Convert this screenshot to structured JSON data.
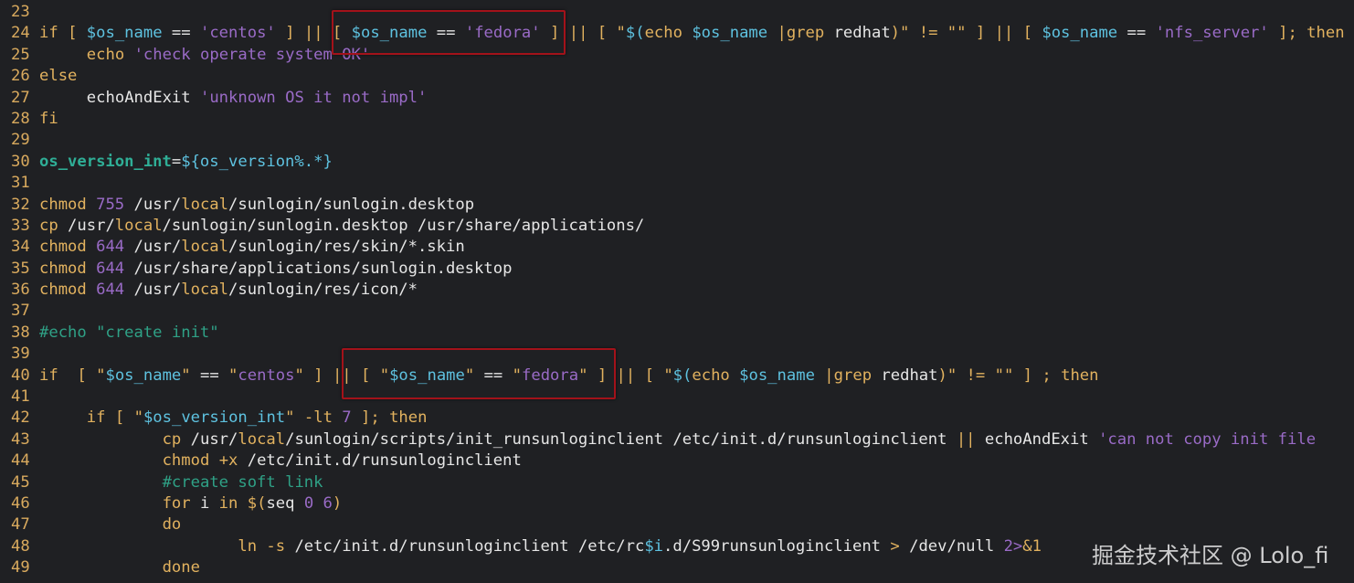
{
  "colors": {
    "background": "#1f2023",
    "keyword": "#e2b25f",
    "string": "#9a6bc7",
    "variable": "#5ec2e0",
    "comment": "#2fa186",
    "highlight_box": "#a3121a"
  },
  "watermark": "掘金技术社区 @ Lolo_fi",
  "lines": [
    {
      "n": "23",
      "tokens": []
    },
    {
      "n": "24",
      "tokens": [
        [
          "k",
          "if"
        ],
        [
          "t",
          " "
        ],
        [
          "k",
          "["
        ],
        [
          "t",
          " "
        ],
        [
          "v",
          "$os_name"
        ],
        [
          "t",
          " == "
        ],
        [
          "s",
          "'centos'"
        ],
        [
          "t",
          " "
        ],
        [
          "k",
          "]"
        ],
        [
          "t",
          " "
        ],
        [
          "k",
          "||"
        ],
        [
          "t",
          " "
        ],
        [
          "k",
          "["
        ],
        [
          "t",
          " "
        ],
        [
          "v",
          "$os_name"
        ],
        [
          "t",
          " == "
        ],
        [
          "s",
          "'fedora'"
        ],
        [
          "t",
          " "
        ],
        [
          "k",
          "]"
        ],
        [
          "t",
          " "
        ],
        [
          "k",
          "||"
        ],
        [
          "t",
          " "
        ],
        [
          "k",
          "["
        ],
        [
          "t",
          " "
        ],
        [
          "k",
          "\""
        ],
        [
          "v",
          "$("
        ],
        [
          "k",
          "echo"
        ],
        [
          "t",
          " "
        ],
        [
          "v",
          "$os_name"
        ],
        [
          "t",
          " "
        ],
        [
          "k",
          "|grep"
        ],
        [
          "t",
          " redhat"
        ],
        [
          "k",
          ")\""
        ],
        [
          "t",
          " "
        ],
        [
          "k",
          "!="
        ],
        [
          "t",
          " "
        ],
        [
          "k",
          "\"\""
        ],
        [
          "t",
          " "
        ],
        [
          "k",
          "]"
        ],
        [
          "t",
          " "
        ],
        [
          "k",
          "||"
        ],
        [
          "t",
          " "
        ],
        [
          "k",
          "["
        ],
        [
          "t",
          " "
        ],
        [
          "v",
          "$os_name"
        ],
        [
          "t",
          " == "
        ],
        [
          "s",
          "'nfs_server'"
        ],
        [
          "t",
          " "
        ],
        [
          "k",
          "];"
        ],
        [
          "t",
          " "
        ],
        [
          "k",
          "then"
        ]
      ]
    },
    {
      "n": "25",
      "tokens": [
        [
          "t",
          "\t"
        ],
        [
          "k",
          "echo"
        ],
        [
          "t",
          " "
        ],
        [
          "s",
          "'check operate system OK'"
        ]
      ]
    },
    {
      "n": "26",
      "tokens": [
        [
          "k",
          "else"
        ]
      ]
    },
    {
      "n": "27",
      "tokens": [
        [
          "t",
          "\techoAndExit "
        ],
        [
          "s",
          "'unknown OS it not impl'"
        ]
      ]
    },
    {
      "n": "28",
      "tokens": [
        [
          "k",
          "fi"
        ]
      ]
    },
    {
      "n": "29",
      "tokens": []
    },
    {
      "n": "30",
      "tokens": [
        [
          "g",
          "os_version_int"
        ],
        [
          "t",
          "="
        ],
        [
          "v",
          "${os_version%.*}"
        ]
      ]
    },
    {
      "n": "31",
      "tokens": []
    },
    {
      "n": "32",
      "tokens": [
        [
          "k",
          "chmod"
        ],
        [
          "t",
          " "
        ],
        [
          "n",
          "755"
        ],
        [
          "t",
          " /usr/"
        ],
        [
          "k",
          "local"
        ],
        [
          "t",
          "/sunlogin/sunlogin.desktop"
        ]
      ]
    },
    {
      "n": "33",
      "tokens": [
        [
          "k",
          "cp"
        ],
        [
          "t",
          " /usr/"
        ],
        [
          "k",
          "local"
        ],
        [
          "t",
          "/sunlogin/sunlogin.desktop /usr/share/applications/"
        ]
      ]
    },
    {
      "n": "34",
      "tokens": [
        [
          "k",
          "chmod"
        ],
        [
          "t",
          " "
        ],
        [
          "n",
          "644"
        ],
        [
          "t",
          " /usr/"
        ],
        [
          "k",
          "local"
        ],
        [
          "t",
          "/sunlogin/res/skin/*.skin"
        ]
      ]
    },
    {
      "n": "35",
      "tokens": [
        [
          "k",
          "chmod"
        ],
        [
          "t",
          " "
        ],
        [
          "n",
          "644"
        ],
        [
          "t",
          " /usr/share/applications/sunlogin.desktop"
        ]
      ]
    },
    {
      "n": "36",
      "tokens": [
        [
          "k",
          "chmod"
        ],
        [
          "t",
          " "
        ],
        [
          "n",
          "644"
        ],
        [
          "t",
          " /usr/"
        ],
        [
          "k",
          "local"
        ],
        [
          "t",
          "/sunlogin/res/icon/*"
        ]
      ]
    },
    {
      "n": "37",
      "tokens": []
    },
    {
      "n": "38",
      "tokens": [
        [
          "c",
          "#echo \"create init\""
        ]
      ]
    },
    {
      "n": "39",
      "tokens": []
    },
    {
      "n": "40",
      "tokens": [
        [
          "k",
          "if"
        ],
        [
          "t",
          "  "
        ],
        [
          "k",
          "["
        ],
        [
          "t",
          " "
        ],
        [
          "k",
          "\""
        ],
        [
          "v",
          "$os_name"
        ],
        [
          "k",
          "\""
        ],
        [
          "t",
          " == "
        ],
        [
          "k",
          "\""
        ],
        [
          "s",
          "centos"
        ],
        [
          "k",
          "\""
        ],
        [
          "t",
          " "
        ],
        [
          "k",
          "]"
        ],
        [
          "t",
          " "
        ],
        [
          "k",
          "||"
        ],
        [
          "t",
          " "
        ],
        [
          "k",
          "["
        ],
        [
          "t",
          " "
        ],
        [
          "k",
          "\""
        ],
        [
          "v",
          "$os_name"
        ],
        [
          "k",
          "\""
        ],
        [
          "t",
          " == "
        ],
        [
          "k",
          "\""
        ],
        [
          "s",
          "fedora"
        ],
        [
          "k",
          "\""
        ],
        [
          "t",
          " "
        ],
        [
          "k",
          "]"
        ],
        [
          "t",
          " "
        ],
        [
          "k",
          "||"
        ],
        [
          "t",
          " "
        ],
        [
          "k",
          "["
        ],
        [
          "t",
          " "
        ],
        [
          "k",
          "\""
        ],
        [
          "v",
          "$("
        ],
        [
          "k",
          "echo"
        ],
        [
          "t",
          " "
        ],
        [
          "v",
          "$os_name"
        ],
        [
          "t",
          " "
        ],
        [
          "k",
          "|grep"
        ],
        [
          "t",
          " redhat"
        ],
        [
          "k",
          ")\""
        ],
        [
          "t",
          " "
        ],
        [
          "k",
          "!="
        ],
        [
          "t",
          " "
        ],
        [
          "k",
          "\"\""
        ],
        [
          "t",
          " "
        ],
        [
          "k",
          "]"
        ],
        [
          "t",
          " "
        ],
        [
          "k",
          ";"
        ],
        [
          "t",
          " "
        ],
        [
          "k",
          "then"
        ]
      ]
    },
    {
      "n": "41",
      "tokens": []
    },
    {
      "n": "42",
      "tokens": [
        [
          "t",
          "\t"
        ],
        [
          "k",
          "if"
        ],
        [
          "t",
          " "
        ],
        [
          "k",
          "["
        ],
        [
          "t",
          " "
        ],
        [
          "k",
          "\""
        ],
        [
          "v",
          "$os_version_int"
        ],
        [
          "k",
          "\""
        ],
        [
          "t",
          " "
        ],
        [
          "k",
          "-lt"
        ],
        [
          "t",
          " "
        ],
        [
          "n",
          "7"
        ],
        [
          "t",
          " "
        ],
        [
          "k",
          "];"
        ],
        [
          "t",
          " "
        ],
        [
          "k",
          "then"
        ]
      ]
    },
    {
      "n": "43",
      "tokens": [
        [
          "t",
          "\t\t"
        ],
        [
          "k",
          "cp"
        ],
        [
          "t",
          " /usr/"
        ],
        [
          "k",
          "local"
        ],
        [
          "t",
          "/sunlogin/scripts/init_runsunloginclient /etc/init.d/runsunloginclient "
        ],
        [
          "k",
          "||"
        ],
        [
          "t",
          " echoAndExit "
        ],
        [
          "s",
          "'can not copy init file"
        ]
      ]
    },
    {
      "n": "44",
      "tokens": [
        [
          "t",
          "\t\t"
        ],
        [
          "k",
          "chmod"
        ],
        [
          "t",
          " "
        ],
        [
          "k",
          "+x"
        ],
        [
          "t",
          " /etc/init.d/runsunloginclient"
        ]
      ]
    },
    {
      "n": "45",
      "tokens": [
        [
          "t",
          "\t\t"
        ],
        [
          "c",
          "#create soft link"
        ]
      ]
    },
    {
      "n": "46",
      "tokens": [
        [
          "t",
          "\t\t"
        ],
        [
          "k",
          "for"
        ],
        [
          "t",
          " i "
        ],
        [
          "k",
          "in"
        ],
        [
          "t",
          " "
        ],
        [
          "k",
          "$("
        ],
        [
          "t",
          "seq "
        ],
        [
          "n",
          "0 6"
        ],
        [
          "k",
          ")"
        ]
      ]
    },
    {
      "n": "47",
      "tokens": [
        [
          "t",
          "\t\t"
        ],
        [
          "k",
          "do"
        ]
      ]
    },
    {
      "n": "48",
      "tokens": [
        [
          "t",
          "\t\t\t"
        ],
        [
          "k",
          "ln -s"
        ],
        [
          "t",
          " /etc/init.d/runsunloginclient /etc/rc"
        ],
        [
          "v",
          "$i"
        ],
        [
          "t",
          ".d/S99runsunloginclient "
        ],
        [
          "k",
          ">"
        ],
        [
          "t",
          " /dev/null "
        ],
        [
          "n",
          "2>"
        ],
        [
          "k",
          "&1"
        ]
      ]
    },
    {
      "n": "49",
      "tokens": [
        [
          "t",
          "\t\t"
        ],
        [
          "k",
          "done"
        ]
      ]
    }
  ]
}
